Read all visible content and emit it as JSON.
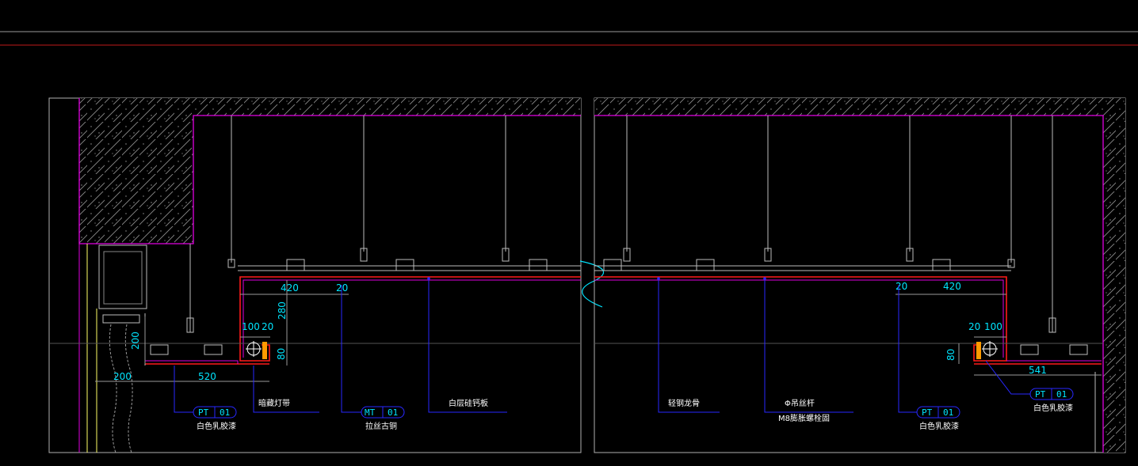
{
  "dims": {
    "left_420": "420",
    "left_20_top": "20",
    "left_280": "280",
    "left_100": "100",
    "left_20_small": "20",
    "left_80": "80",
    "left_200_v": "200",
    "left_200_h": "200",
    "left_520": "520",
    "right_20_top": "20",
    "right_420": "420",
    "right_20_small": "20",
    "right_100": "100",
    "right_80": "80",
    "right_541": "541"
  },
  "tags": [
    {
      "code": "PT",
      "num": "01",
      "desc": "白色乳胶漆"
    },
    {
      "code": "MT",
      "num": "01",
      "desc": "拉丝古铜"
    },
    {
      "code": "PT",
      "num": "01",
      "desc": "白色乳胶漆"
    },
    {
      "code": "PT",
      "num": "01",
      "desc": "白色乳胶漆"
    }
  ],
  "notes": {
    "hidden_light": "暗藏灯带",
    "gypsum_board": "白层硅钙板",
    "steel_keel": "轻钢龙骨",
    "hanger_rod": "Φ吊丝杆",
    "bolt": "M8膨胀螺栓固"
  },
  "colors": {
    "background": "#000000",
    "wall_outline": "#e100e1",
    "finish_line": "#ff1a1a",
    "leader": "#2828ff",
    "dimension": "#00e5ff",
    "frame": "#c0c0c0"
  }
}
